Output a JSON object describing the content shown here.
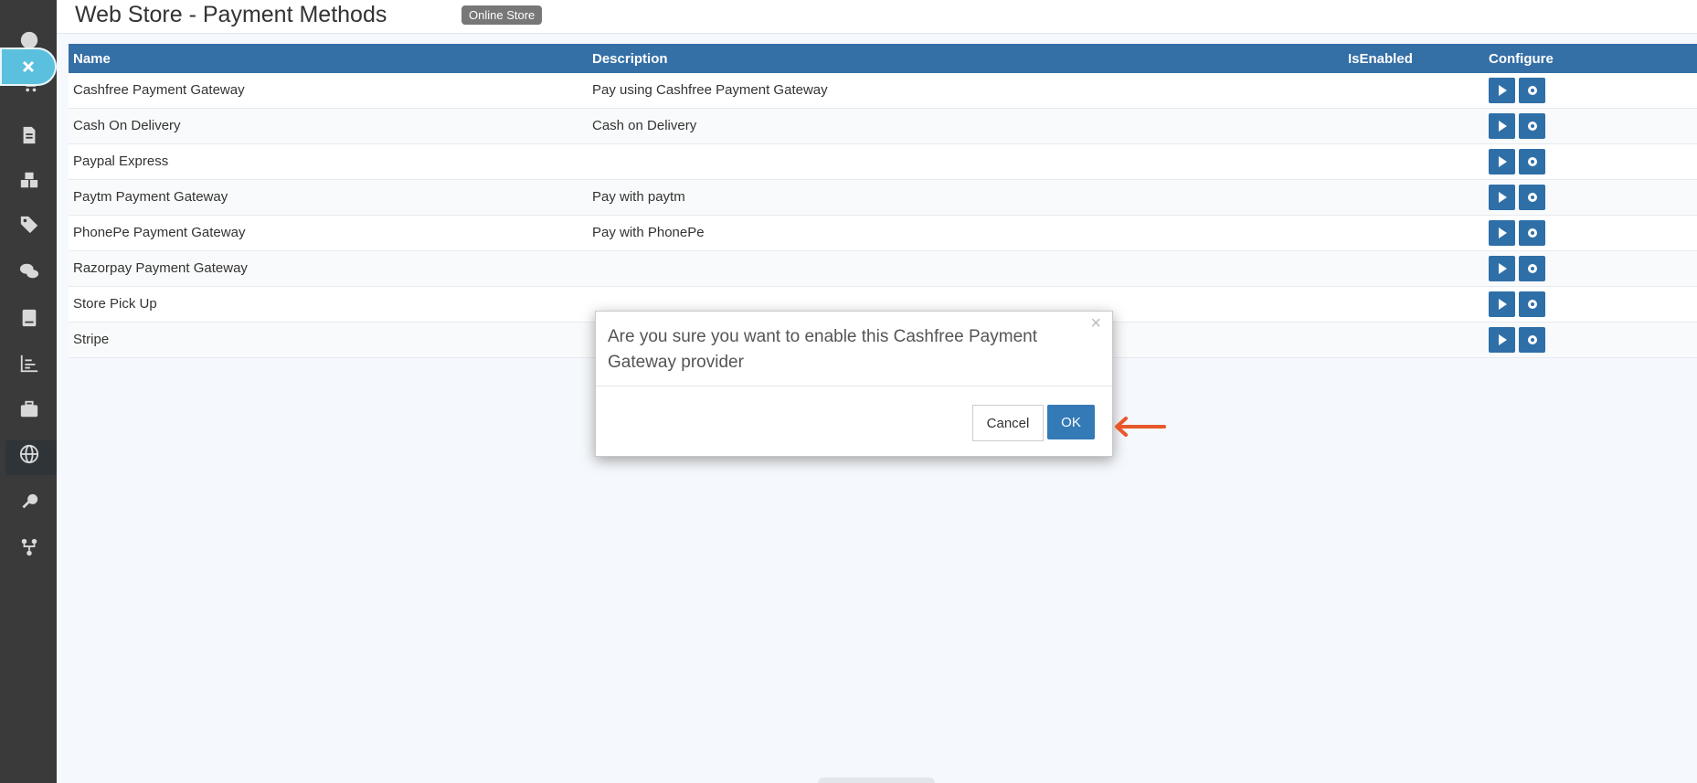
{
  "header": {
    "title": "Web Store - Payment Methods",
    "badge": "Online Store"
  },
  "table": {
    "columns": [
      "Name",
      "Description",
      "IsEnabled",
      "Configure"
    ],
    "rows": [
      {
        "name": "Cashfree Payment Gateway",
        "description": "Pay using Cashfree Payment Gateway"
      },
      {
        "name": "Cash On Delivery",
        "description": "Cash on Delivery"
      },
      {
        "name": "Paypal Express",
        "description": ""
      },
      {
        "name": "Paytm Payment Gateway",
        "description": "Pay with paytm"
      },
      {
        "name": "PhonePe Payment Gateway",
        "description": "Pay with PhonePe"
      },
      {
        "name": "Razorpay Payment Gateway",
        "description": ""
      },
      {
        "name": "Store Pick Up",
        "description": ""
      },
      {
        "name": "Stripe",
        "description": ""
      }
    ]
  },
  "modal": {
    "message": "Are you sure you want to enable this Cashfree Payment Gateway provider",
    "close_symbol": "×",
    "cancel_label": "Cancel",
    "ok_label": "OK"
  },
  "colors": {
    "header_bar": "#346fa6",
    "button_blue": "#2f6fa8",
    "sidebar": "#3a3a3a",
    "close_pill": "#5bc0de",
    "arrow": "#e8572a"
  },
  "sidebar_icons": [
    "dashboard-icon",
    "cart-icon",
    "document-icon",
    "boxes-icon",
    "tags-icon",
    "comments-icon",
    "book-icon",
    "bar-chart-icon",
    "briefcase-icon",
    "globe-icon",
    "key-icon",
    "fork-icon"
  ]
}
